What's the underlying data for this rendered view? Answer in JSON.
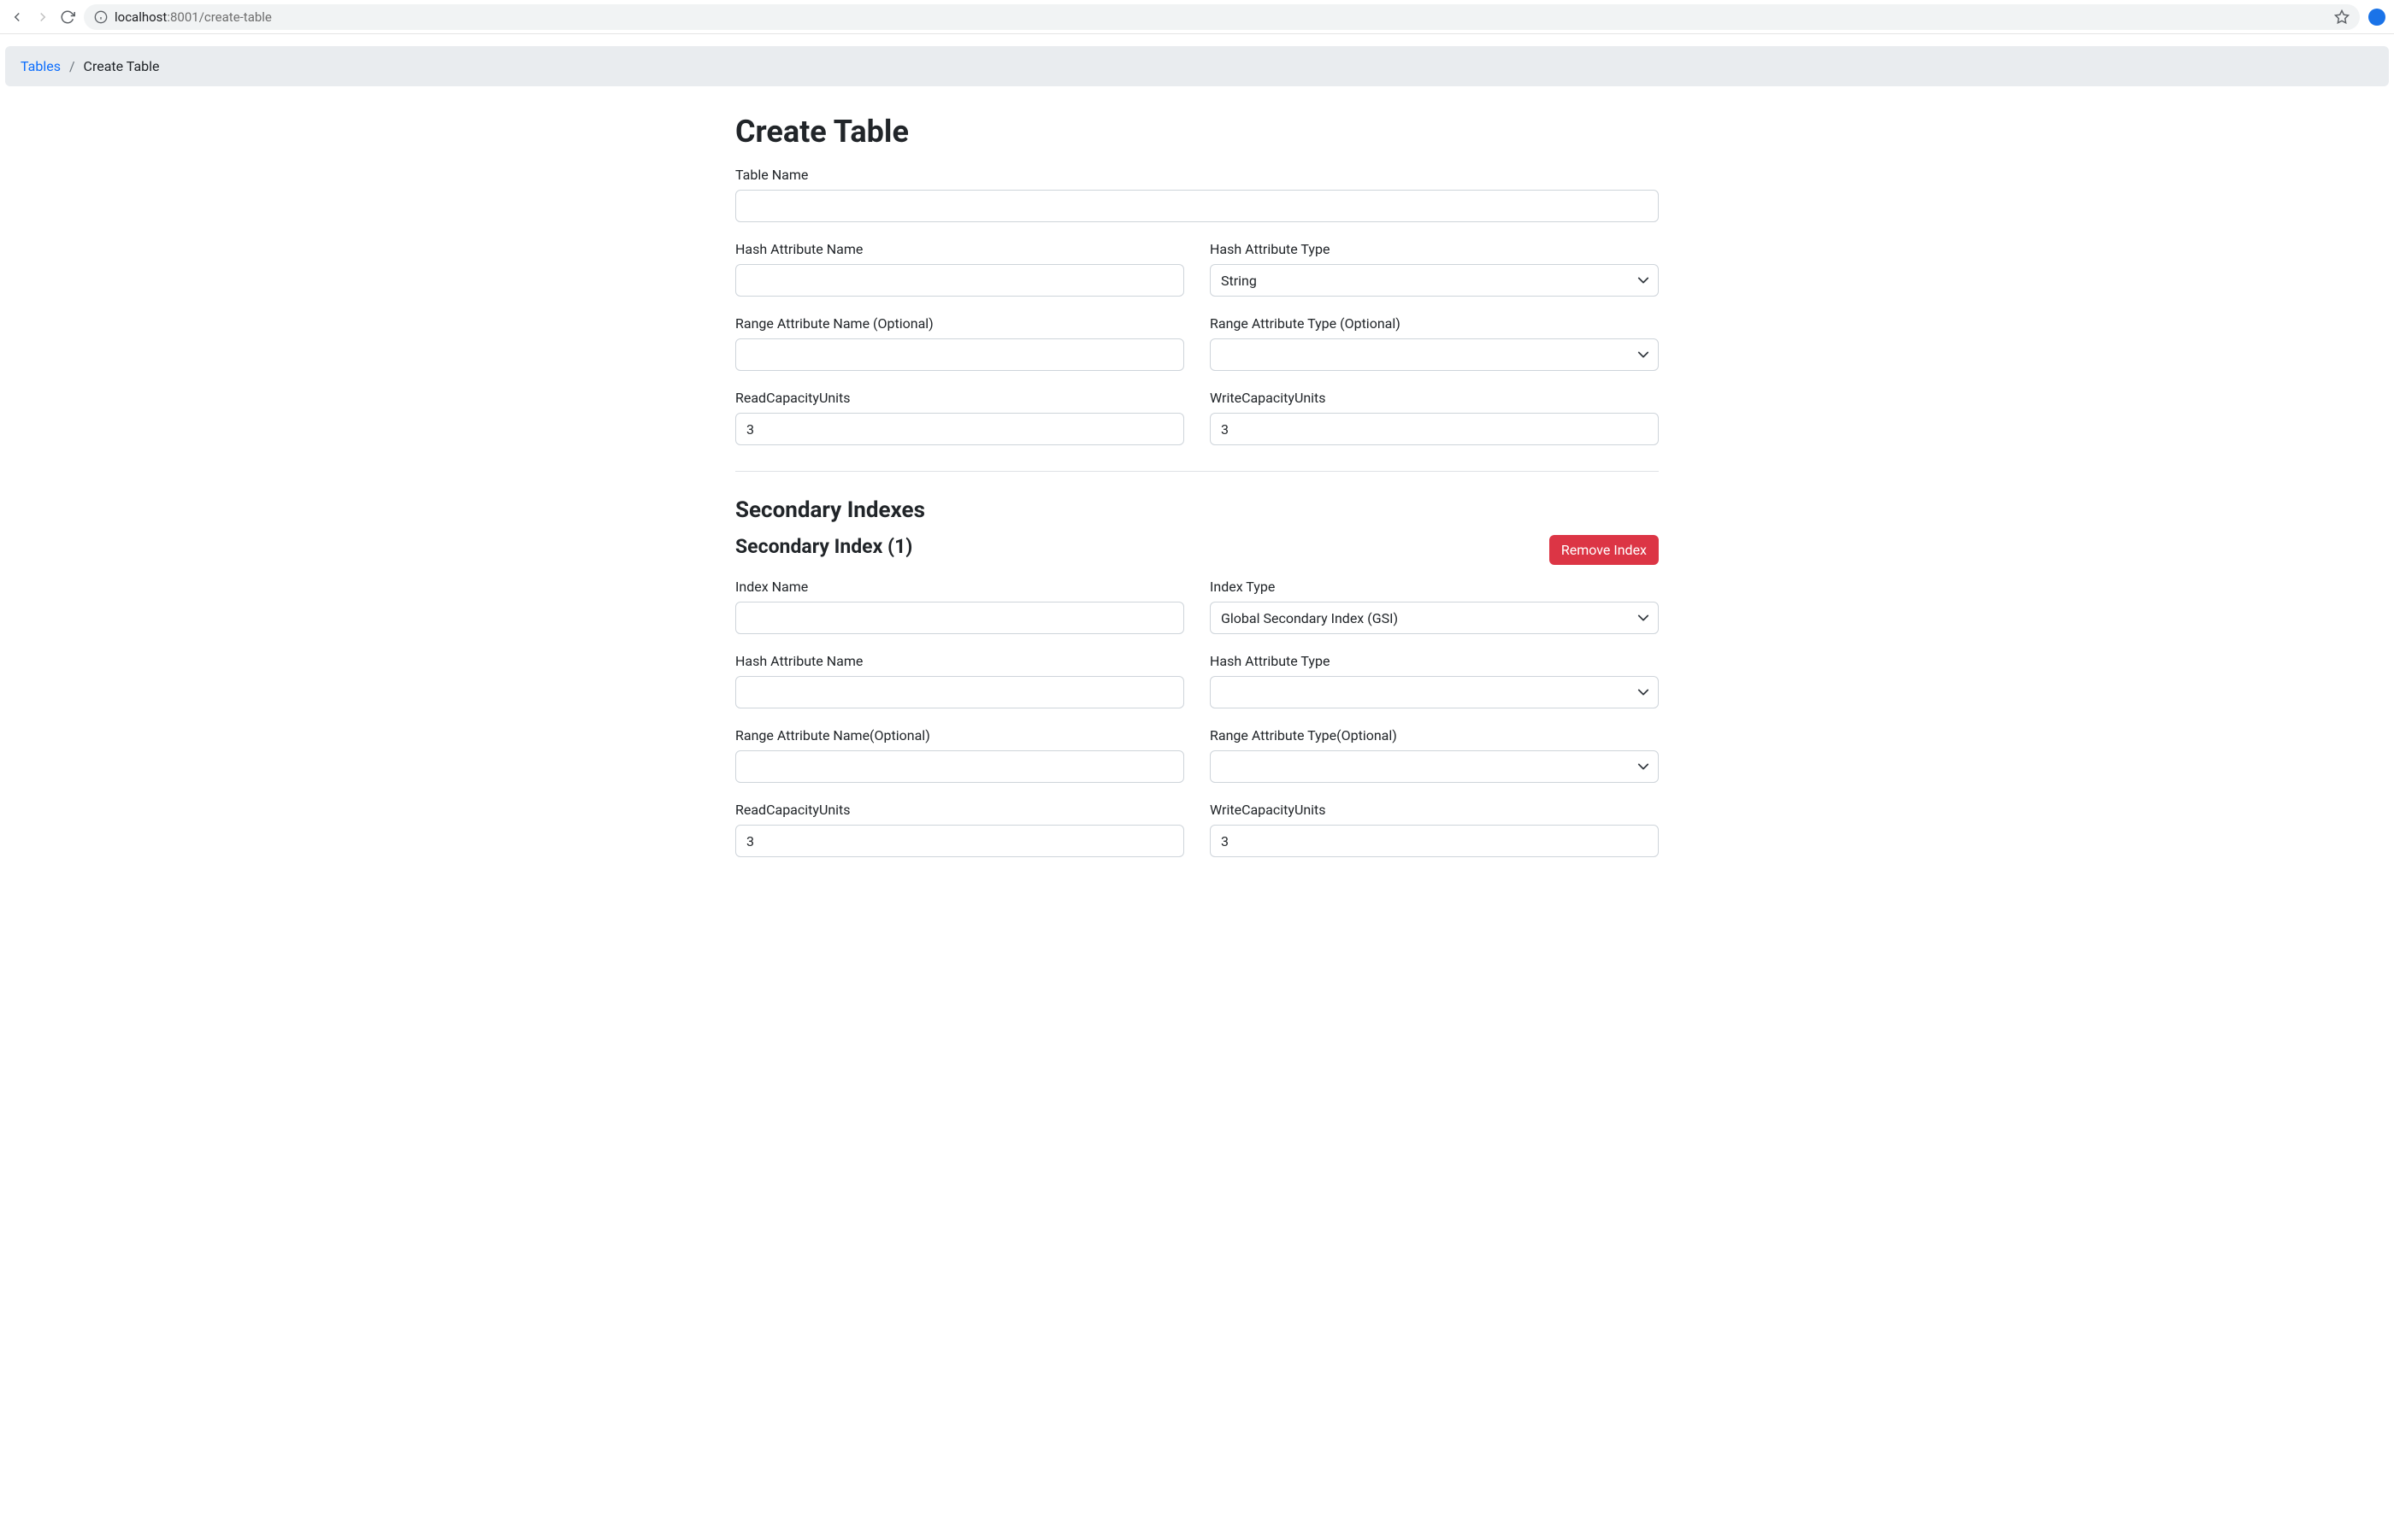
{
  "browser": {
    "url_host": "localhost",
    "url_port": ":8001",
    "url_path": "/create-table"
  },
  "breadcrumb": {
    "root": "Tables",
    "separator": "/",
    "current": "Create Table"
  },
  "page": {
    "title": "Create Table"
  },
  "form": {
    "table_name_label": "Table Name",
    "table_name_value": "",
    "hash_attr_name_label": "Hash Attribute Name",
    "hash_attr_name_value": "",
    "hash_attr_type_label": "Hash Attribute Type",
    "hash_attr_type_value": "String",
    "range_attr_name_label": "Range Attribute Name (Optional)",
    "range_attr_name_value": "",
    "range_attr_type_label": "Range Attribute Type (Optional)",
    "range_attr_type_value": "",
    "read_capacity_label": "ReadCapacityUnits",
    "read_capacity_value": "3",
    "write_capacity_label": "WriteCapacityUnits",
    "write_capacity_value": "3"
  },
  "secondary": {
    "heading": "Secondary Indexes",
    "index_title": "Secondary Index (1)",
    "remove_label": "Remove Index",
    "index_name_label": "Index Name",
    "index_name_value": "",
    "index_type_label": "Index Type",
    "index_type_value": "Global Secondary Index (GSI)",
    "hash_attr_name_label": "Hash Attribute Name",
    "hash_attr_name_value": "",
    "hash_attr_type_label": "Hash Attribute Type",
    "hash_attr_type_value": "",
    "range_attr_name_label": "Range Attribute Name(Optional)",
    "range_attr_name_value": "",
    "range_attr_type_label": "Range Attribute Type(Optional)",
    "range_attr_type_value": "",
    "read_capacity_label": "ReadCapacityUnits",
    "read_capacity_value": "3",
    "write_capacity_label": "WriteCapacityUnits",
    "write_capacity_value": "3"
  }
}
